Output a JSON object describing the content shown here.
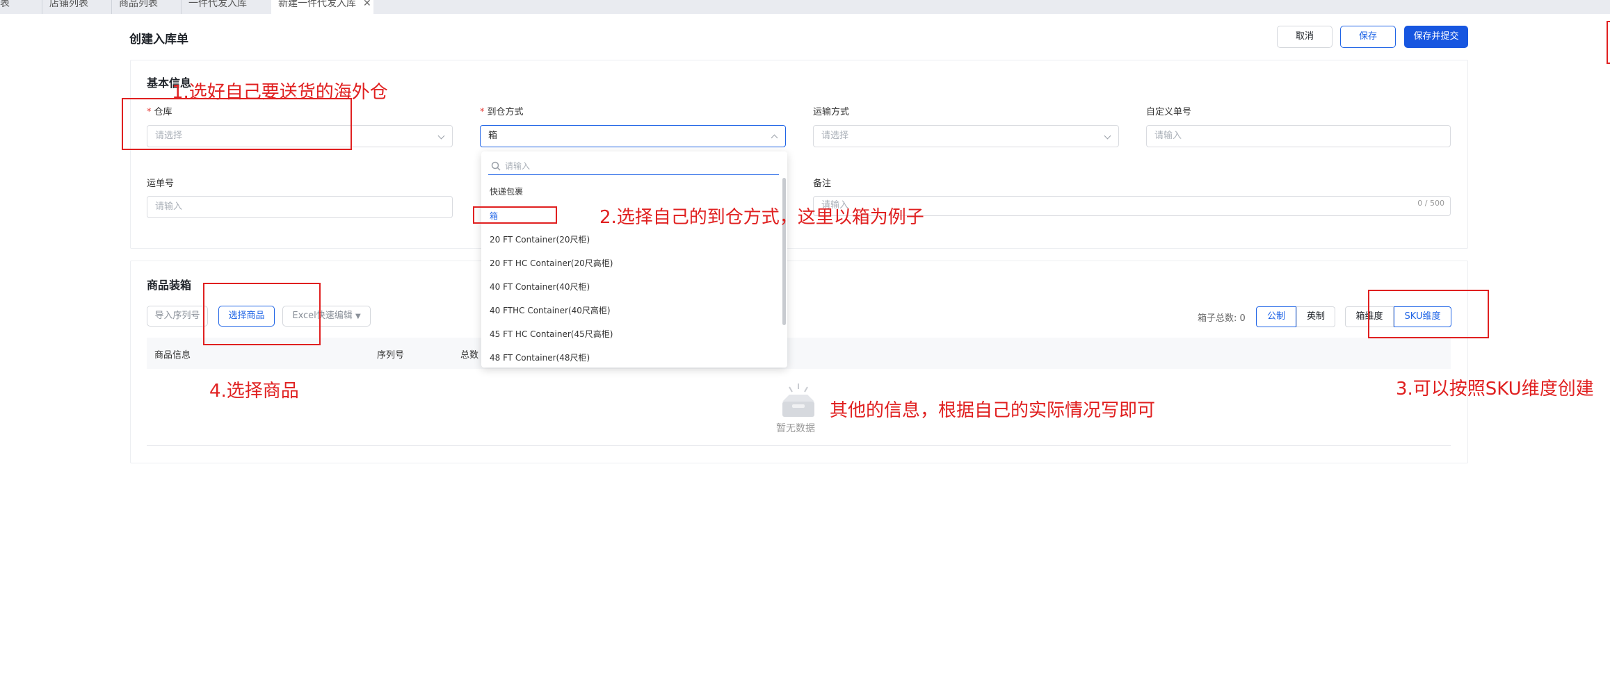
{
  "tabs": [
    {
      "label": "表"
    },
    {
      "label": "店铺列表"
    },
    {
      "label": "商品列表"
    },
    {
      "label": "一件代发入库"
    },
    {
      "label": "新建一件代发入库",
      "close": "✕"
    }
  ],
  "page": {
    "title": "创建入库单"
  },
  "actions": {
    "cancel": "取消",
    "save": "保存",
    "save_submit": "保存并提交"
  },
  "basic_info": {
    "title": "基本信息",
    "warehouse": {
      "label": "仓库",
      "placeholder": "请选择"
    },
    "arrival_method": {
      "label": "到仓方式",
      "value": "箱"
    },
    "transport": {
      "label": "运输方式",
      "placeholder": "请选择"
    },
    "custom_no": {
      "label": "自定义单号",
      "placeholder": "请输入"
    },
    "tracking_no": {
      "label": "运单号",
      "placeholder": "请输入"
    },
    "remark": {
      "label": "备注",
      "placeholder": "请输入",
      "count": "0 / 500"
    }
  },
  "dropdown": {
    "search_placeholder": "请输入",
    "options": [
      "快递包裹",
      "箱",
      "20 FT Container(20尺柜)",
      "20 FT HC Container(20尺高柜)",
      "40 FT Container(40尺柜)",
      "40 FTHC Container(40尺高柜)",
      "45 FT HC Container(45尺高柜)",
      "48 FT Container(48尺柜)"
    ],
    "selected_index": 1
  },
  "packing": {
    "title": "商品装箱",
    "import_serial": "导入序列号",
    "select_goods": "选择商品",
    "excel_edit": "Excel快速编辑",
    "box_total": "箱子总数: 0",
    "unit_metric": "公制",
    "unit_imperial": "英制",
    "dim_box": "箱维度",
    "dim_sku": "SKU维度",
    "columns": [
      "商品信息",
      "序列号",
      "总数"
    ],
    "empty": "暂无数据"
  },
  "annotations": {
    "a1": "1.选好自己要送货的海外仓",
    "a2": "2.选择自己的到仓方式，这里以箱为例子",
    "a3": "3.可以按照SKU维度创建",
    "a4": "4.选择商品",
    "a5": "其他的信息，根据自己的实际情况写即可"
  },
  "colors": {
    "primary": "#1756e0",
    "annotation": "#e02020",
    "required": "#e53935"
  }
}
